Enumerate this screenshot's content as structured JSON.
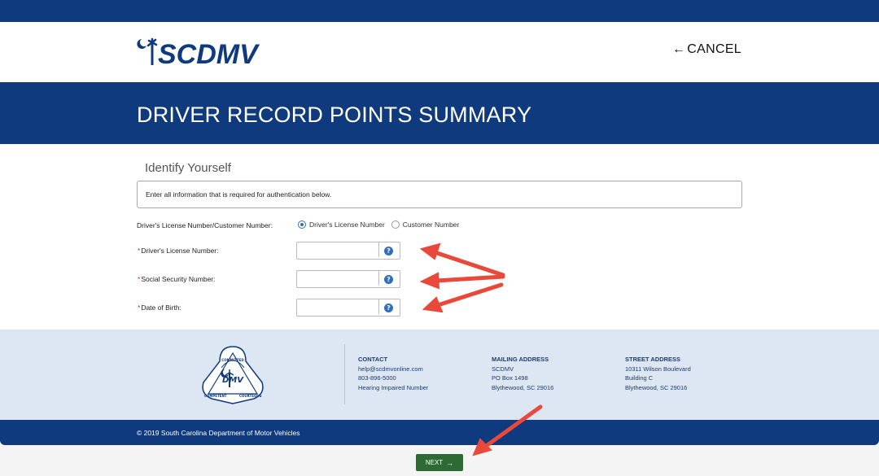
{
  "header": {
    "logo_text": "SCDMV",
    "cancel_label": "CANCEL"
  },
  "banner": {
    "title": "DRIVER RECORD POINTS SUMMARY"
  },
  "form": {
    "section_title": "Identify Yourself",
    "instructions": "Enter all information that is required for authentication below.",
    "id_type_label": "Driver's License Number/Customer Number:",
    "id_type_options": [
      {
        "label": "Driver's License Number",
        "selected": true
      },
      {
        "label": "Customer Number",
        "selected": false
      }
    ],
    "fields": [
      {
        "label": "Driver's License Number:",
        "required_mark": "*",
        "value": "",
        "help_icon": "question-circle-icon"
      },
      {
        "label": "Social Security Number:",
        "required_mark": "*",
        "value": "",
        "help_icon": "question-circle-icon"
      },
      {
        "label": "Date of Birth:",
        "required_mark": "*",
        "value": "",
        "help_icon": "question-circle-icon"
      }
    ]
  },
  "footer": {
    "seal_words": [
      "COMMITTED",
      "DMV",
      "COMPETENT",
      "COURTEOUS"
    ],
    "contact": {
      "heading": "CONTACT",
      "lines": [
        "help@scdmvonline.com",
        "803-896-5000",
        "Hearing Impaired Number"
      ]
    },
    "mailing": {
      "heading": "MAILING ADDRESS",
      "lines": [
        "SCDMV",
        "PO Box 1498",
        "Blythewood, SC 29016"
      ]
    },
    "street": {
      "heading": "STREET ADDRESS",
      "lines": [
        "10311 Wilson Boulevard",
        "Building C",
        "Blythewood, SC 29016"
      ]
    },
    "copyright": "© 2019 South Carolina Department of Motor Vehicles"
  },
  "actions": {
    "next_label": "NEXT"
  },
  "colors": {
    "brand_navy": "#0f3a7d",
    "next_green": "#2e6b34",
    "annotation_red": "#e8493b",
    "footer_bg": "#dde6f3"
  }
}
